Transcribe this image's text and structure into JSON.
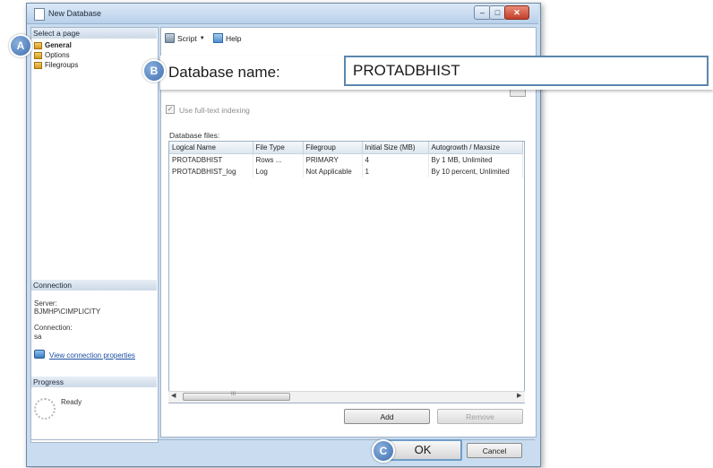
{
  "window": {
    "title": "New Database"
  },
  "left_pane": {
    "select_page_header": "Select a page",
    "pages": [
      {
        "label": "General"
      },
      {
        "label": "Options"
      },
      {
        "label": "Filegroups"
      }
    ],
    "connection_header": "Connection",
    "server_label": "Server:",
    "server_value": "BJMHP\\CIMPLICITY",
    "connection_label": "Connection:",
    "connection_value": "sa",
    "view_connection_link": "View connection properties",
    "progress_header": "Progress",
    "progress_status": "Ready"
  },
  "toolbar": {
    "script_label": "Script",
    "help_label": "Help"
  },
  "general": {
    "database_name_label": "Database name:",
    "database_name_value": "PROTADBHIST",
    "fulltext_label": "Use full-text indexing",
    "database_files_label": "Database files:"
  },
  "grid": {
    "headers": [
      "Logical Name",
      "File Type",
      "Filegroup",
      "Initial Size (MB)",
      "Autogrowth / Maxsize"
    ],
    "rows": [
      [
        "PROTADBHIST",
        "Rows ...",
        "PRIMARY",
        "4",
        "By 1 MB, Unlimited"
      ],
      [
        "PROTADBHIST_log",
        "Log",
        "Not Applicable",
        "1",
        "By 10 percent, Unlimited"
      ]
    ],
    "scroll_thumb_grip": "III"
  },
  "buttons": {
    "add": "Add",
    "remove": "Remove",
    "ok": "OK",
    "cancel": "Cancel"
  },
  "callouts": {
    "a": "A",
    "b": "B",
    "c": "C"
  }
}
